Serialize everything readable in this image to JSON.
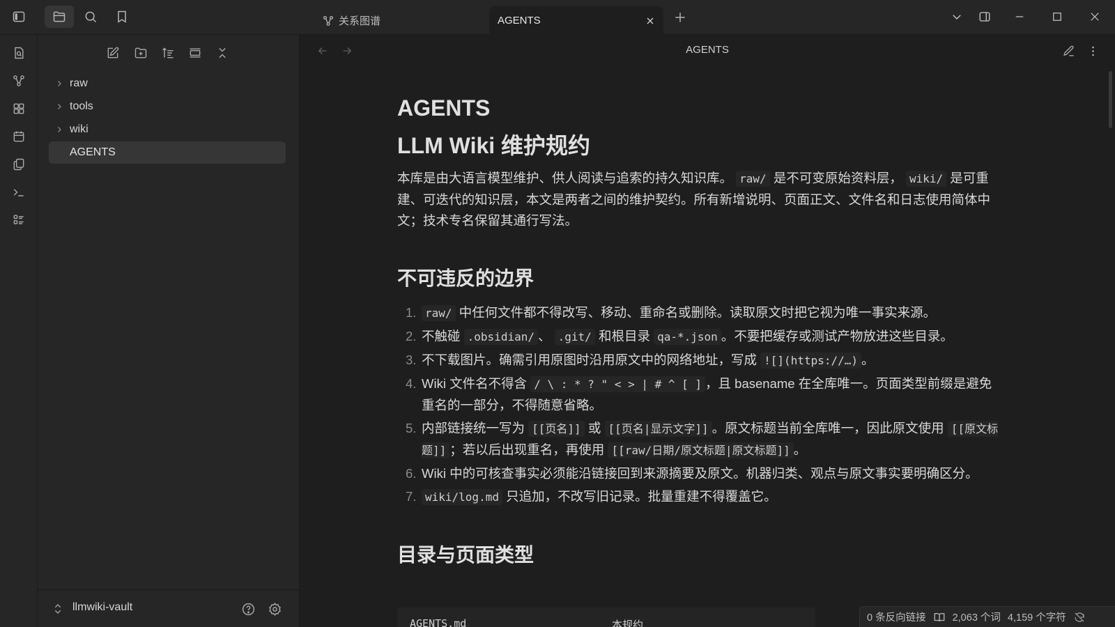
{
  "titlebar": {
    "tabs": [
      {
        "label": "关系图谱",
        "icon": "graph-icon",
        "active": false
      },
      {
        "label": "AGENTS",
        "active": true
      }
    ]
  },
  "sidebar": {
    "tree": [
      {
        "label": "raw",
        "type": "folder"
      },
      {
        "label": "tools",
        "type": "folder"
      },
      {
        "label": "wiki",
        "type": "folder"
      },
      {
        "label": "AGENTS",
        "type": "file",
        "selected": true
      }
    ],
    "vault_name": "llmwiki-vault"
  },
  "view": {
    "title": "AGENTS"
  },
  "doc": {
    "title": "AGENTS",
    "h1": "LLM Wiki 维护规约",
    "intro": {
      "t1": "本库是由大语言模型维护、供人阅读与追索的持久知识库。",
      "c1": "raw/",
      "t2": "是不可变原始资料层，",
      "c2": "wiki/",
      "t3": "是可重建、可迭代的知识层，本文是两者之间的维护契约。所有新增说明、页面正文、文件名和日志使用简体中文；技术专名保留其通行写法。"
    },
    "section1_title": "不可违反的边界",
    "rules": {
      "r1": {
        "num": "1.",
        "c1": "raw/",
        "t1": "中任何文件都不得改写、移动、重命名或删除。读取原文时把它视为唯一事实来源。"
      },
      "r2": {
        "num": "2.",
        "t1": "不触碰",
        "c1": ".obsidian/",
        "t2": "、",
        "c2": ".git/",
        "t3": "和根目录",
        "c3": "qa-*.json",
        "t4": "。不要把缓存或测试产物放进这些目录。"
      },
      "r3": {
        "num": "3.",
        "t1": "不下载图片。确需引用原图时沿用原文中的网络地址，写成",
        "c1": "![](https://…)",
        "t2": "。"
      },
      "r4": {
        "num": "4.",
        "t1": "Wiki 文件名不得含",
        "c1": "/ \\ : * ? \" < > | # ^ [ ]",
        "t2": "，且 basename 在全库唯一。页面类型前缀是避免重名的一部分，不得随意省略。"
      },
      "r5": {
        "num": "5.",
        "t1": "内部链接统一写为",
        "c1": "[[页名]]",
        "t2": "或",
        "c2": "[[页名|显示文字]]",
        "t3": "。原文标题当前全库唯一，因此原文使用",
        "c3": "[[原文标题]]",
        "t4": "；若以后出现重名，再使用",
        "c4": "[[raw/日期/原文标题|原文标题]]",
        "t5": "。"
      },
      "r6": {
        "num": "6.",
        "t1": "Wiki 中的可核查事实必须能沿链接回到来源摘要及原文。机器归类、观点与原文事实要明确区分。"
      },
      "r7": {
        "num": "7.",
        "c1": "wiki/log.md",
        "t1": "只追加，不改写旧记录。批量重建不得覆盖它。"
      }
    },
    "section2_title": "目录与页面类型",
    "table_peek": {
      "col1": "AGENTS.md",
      "col2": "本规约"
    }
  },
  "statusbar": {
    "backlinks": "0 条反向链接",
    "words": "2,063 个词",
    "chars": "4,159 个字符"
  }
}
